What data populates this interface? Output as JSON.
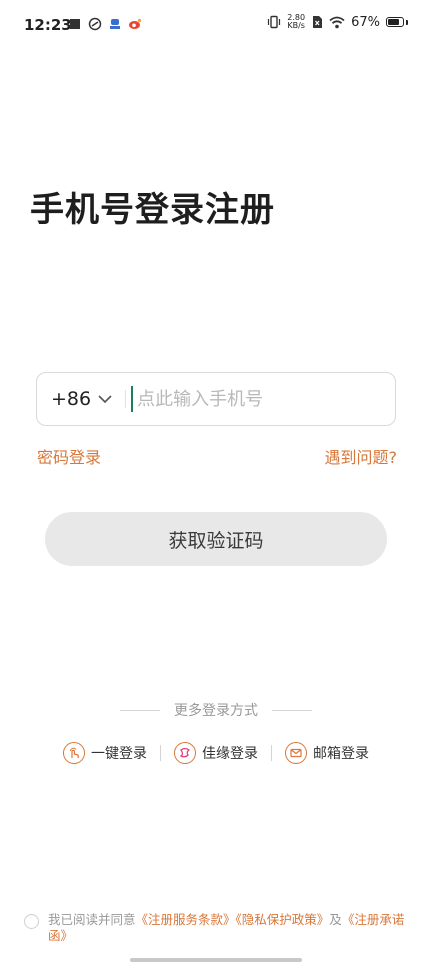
{
  "status_bar": {
    "time": "12:23",
    "net_speed_value": "2.80",
    "net_speed_unit": "KB/s",
    "battery": "67%",
    "icons": [
      "stop-icon",
      "app-icon",
      "app-icon",
      "weibo-icon",
      "vibrate-icon",
      "no-sim-icon",
      "wifi-icon",
      "battery-icon"
    ]
  },
  "title": "手机号登录注册",
  "phone": {
    "country_code": "+86",
    "placeholder": "点此输入手机号",
    "value": ""
  },
  "links": {
    "password_login": "密码登录",
    "help": "遇到问题?"
  },
  "button": {
    "get_code": "获取验证码"
  },
  "more_login": {
    "heading": "更多登录方式",
    "options": [
      {
        "label": "一键登录",
        "icon": "touch-icon"
      },
      {
        "label": "佳缘登录",
        "icon": "jiayuan-icon"
      },
      {
        "label": "邮箱登录",
        "icon": "mail-icon"
      }
    ]
  },
  "agreement": {
    "prefix": "我已阅读并同意",
    "terms": "《注册服务条款》",
    "privacy": "《隐私保护政策》",
    "and": "及",
    "pledge": "《注册承诺函》"
  },
  "colors": {
    "accent": "#d8773a",
    "button_bg": "#e8e8e8",
    "caret": "#1a7f5a"
  }
}
